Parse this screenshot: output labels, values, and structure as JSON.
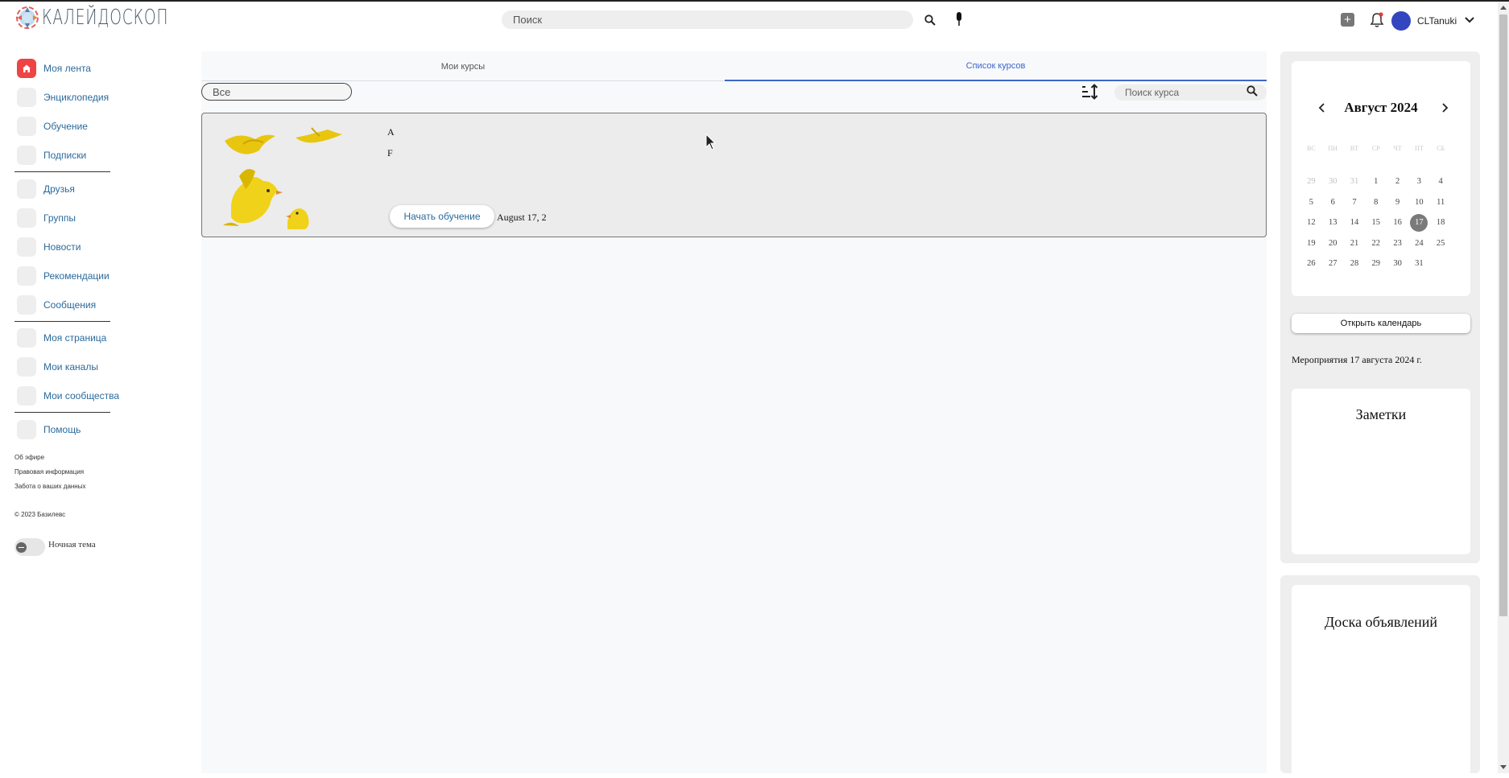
{
  "header": {
    "logo_text": "КАЛЕЙДОСКОП",
    "search_placeholder": "Поиск",
    "username": "CLTanuki",
    "icons": [
      "search-icon",
      "microphone-icon",
      "plus-icon",
      "bell-icon",
      "chevron-down-icon"
    ],
    "notification_dot_color": "#e53935",
    "avatar_color": "#3445c0"
  },
  "sidebar": {
    "items": [
      {
        "label": "Моя лента",
        "icon": "home-icon",
        "active": true
      },
      {
        "label": "Энциклопедия"
      },
      {
        "label": "Обучение"
      },
      {
        "label": "Подписки"
      },
      {
        "label": "Друзья"
      },
      {
        "label": "Группы"
      },
      {
        "label": "Новости"
      },
      {
        "label": "Рекомендации"
      },
      {
        "label": "Сообщения"
      },
      {
        "label": "Моя страница"
      },
      {
        "label": "Мои каналы"
      },
      {
        "label": "Мои сообщества"
      },
      {
        "label": "Помощь"
      }
    ],
    "links": [
      "Об эфире",
      "Правовая информация",
      "Забота о ваших данных"
    ],
    "copyright": "© 2023 Базилевс",
    "night_theme_label": "Ночная тема",
    "night_theme_on": false,
    "accent_color": "#ee4444",
    "link_color": "#2a6a9c"
  },
  "main": {
    "tabs": [
      {
        "label": "Мои курсы",
        "active": false
      },
      {
        "label": "Список курсов",
        "active": true
      }
    ],
    "filter_value": "Все",
    "course_search_placeholder": "Поиск курса",
    "courses": [
      {
        "title": "A",
        "description": "F",
        "button_label": "Начать обучение",
        "date": "August 17, 2"
      }
    ],
    "tab_accent_color": "#3f67c6"
  },
  "calendar": {
    "month_title": "Август 2024",
    "weekdays": [
      "ВС",
      "ПН",
      "ВТ",
      "СР",
      "ЧТ",
      "ПТ",
      "СБ"
    ],
    "weeks": [
      [
        {
          "d": "29",
          "o": true
        },
        {
          "d": "30",
          "o": true
        },
        {
          "d": "31",
          "o": true
        },
        {
          "d": "1"
        },
        {
          "d": "2"
        },
        {
          "d": "3"
        },
        {
          "d": "4"
        }
      ],
      [
        {
          "d": "5"
        },
        {
          "d": "6"
        },
        {
          "d": "7"
        },
        {
          "d": "8"
        },
        {
          "d": "9"
        },
        {
          "d": "10"
        },
        {
          "d": "11"
        }
      ],
      [
        {
          "d": "12"
        },
        {
          "d": "13"
        },
        {
          "d": "14"
        },
        {
          "d": "15"
        },
        {
          "d": "16"
        },
        {
          "d": "17",
          "t": true
        },
        {
          "d": "18"
        }
      ],
      [
        {
          "d": "19"
        },
        {
          "d": "20"
        },
        {
          "d": "21"
        },
        {
          "d": "22"
        },
        {
          "d": "23"
        },
        {
          "d": "24"
        },
        {
          "d": "25"
        }
      ],
      [
        {
          "d": "26"
        },
        {
          "d": "27"
        },
        {
          "d": "28"
        },
        {
          "d": "29"
        },
        {
          "d": "30"
        },
        {
          "d": "31"
        }
      ]
    ],
    "open_button_label": "Открыть календарь",
    "events_label": "Мероприятия 17 августа 2024 г."
  },
  "notes": {
    "title": "Заметки"
  },
  "board": {
    "title": "Доска объявлений"
  }
}
